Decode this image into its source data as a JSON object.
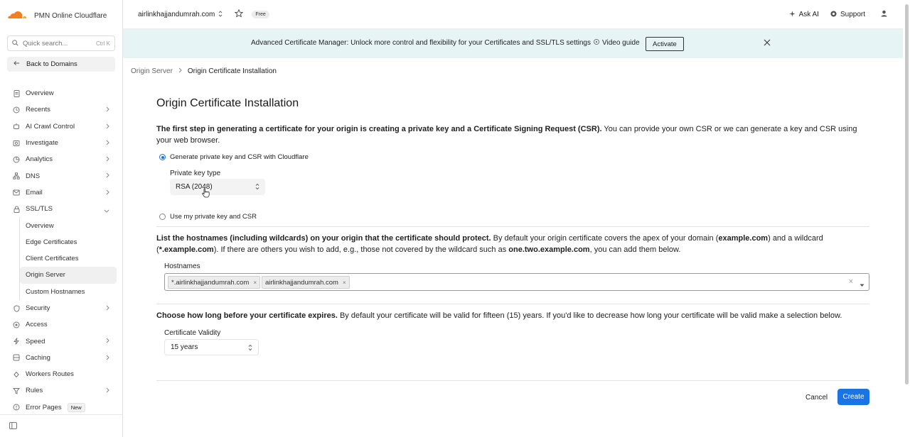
{
  "brand": {
    "name": "PMN Online Cloudflare",
    "logo_icon": "cloudflare-logo"
  },
  "search": {
    "placeholder": "Quick search...",
    "shortcut": "Ctrl K"
  },
  "back_label": "Back to Domains",
  "sidebar": {
    "items": [
      {
        "label": "Overview",
        "icon": "document-icon",
        "chevron": false
      },
      {
        "label": "Recents",
        "icon": "clock-icon",
        "chevron": true
      },
      {
        "label": "AI Crawl Control",
        "icon": "robot-icon",
        "chevron": true
      },
      {
        "label": "Investigate",
        "icon": "investigate-icon",
        "chevron": true
      },
      {
        "label": "Analytics",
        "icon": "chart-icon",
        "chevron": true
      },
      {
        "label": "DNS",
        "icon": "network-icon",
        "chevron": true
      },
      {
        "label": "Email",
        "icon": "mail-icon",
        "chevron": true
      },
      {
        "label": "SSL/TLS",
        "icon": "lock-icon",
        "chevron": true,
        "expanded": true
      }
    ],
    "ssl_sub": [
      {
        "label": "Overview"
      },
      {
        "label": "Edge Certificates"
      },
      {
        "label": "Client Certificates"
      },
      {
        "label": "Origin Server",
        "active": true
      },
      {
        "label": "Custom Hostnames"
      }
    ],
    "items_after": [
      {
        "label": "Security",
        "icon": "shield-icon",
        "chevron": true
      },
      {
        "label": "Access",
        "icon": "access-icon",
        "chevron": false
      },
      {
        "label": "Speed",
        "icon": "bolt-icon",
        "chevron": true
      },
      {
        "label": "Caching",
        "icon": "cache-icon",
        "chevron": true
      },
      {
        "label": "Workers Routes",
        "icon": "workers-icon",
        "chevron": false
      },
      {
        "label": "Rules",
        "icon": "rules-icon",
        "chevron": true
      },
      {
        "label": "Error Pages",
        "icon": "error-icon",
        "chevron": false,
        "badge": "New"
      }
    ]
  },
  "topbar": {
    "domain": "airlinkhajjandumrah.com",
    "plan_badge": "Free",
    "ask_ai": "Ask AI",
    "support": "Support"
  },
  "banner": {
    "text": "Advanced Certificate Manager: Unlock more control and flexibility for your Certificates and SSL/TLS settings",
    "video_guide": "Video guide",
    "activate": "Activate"
  },
  "breadcrumb": {
    "parent": "Origin Server",
    "current": "Origin Certificate Installation"
  },
  "page": {
    "title": "Origin Certificate Installation",
    "intro_bold": "The first step in generating a certificate for your origin is creating a private key and a Certificate Signing Request (CSR).",
    "intro_rest": " You can provide your own CSR or we can generate a key and CSR using your web browser.",
    "radio_generate": "Generate private key and CSR with Cloudflare",
    "key_type_label": "Private key type",
    "key_type_value": "RSA (2048)",
    "radio_own": "Use my private key and CSR",
    "hosts_bold": "List the hostnames (including wildcards) on your origin that the certificate should protect.",
    "hosts_rest_1": " By default your origin certificate covers the apex of your domain (",
    "hosts_example": "example.com",
    "hosts_rest_2": ") and a wildcard (",
    "hosts_wildcard": "*.example.com",
    "hosts_rest_3": "). If there are others you wish to add, e.g., those not covered by the wildcard such as ",
    "hosts_nested": "one.two.example.com",
    "hosts_rest_4": ", you can add them below.",
    "hostnames_label": "Hostnames",
    "hostnames": [
      "*.airlinkhajjandumrah.com",
      "airlinkhajjandumrah.com"
    ],
    "expiry_bold": "Choose how long before your certificate expires.",
    "expiry_rest": " By default your certificate will be valid for fifteen (15) years. If you'd like to decrease how long your certificate will be valid make a selection below.",
    "validity_label": "Certificate Validity",
    "validity_value": "15 years",
    "cancel": "Cancel",
    "create": "Create"
  },
  "colors": {
    "accent": "#1b74e4",
    "banner_bg": "#e6f4f6",
    "logo_orange": "#f38020"
  }
}
